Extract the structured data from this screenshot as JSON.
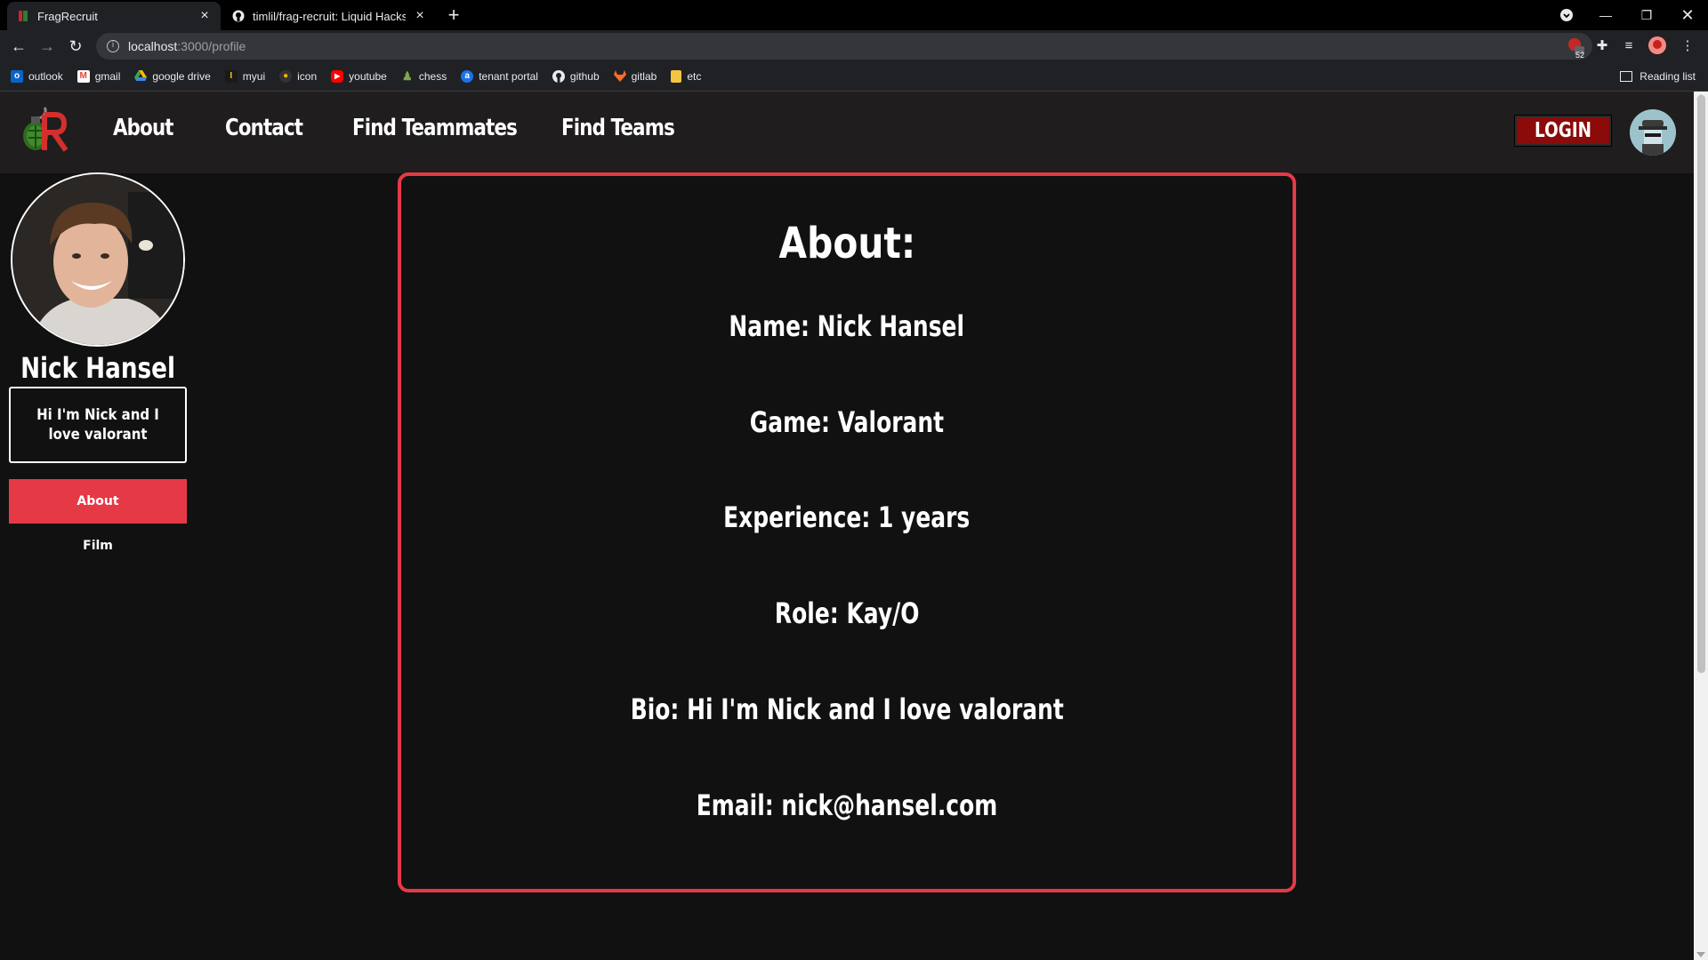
{
  "browser": {
    "tabs": [
      {
        "title": "FragRecruit",
        "active": true
      },
      {
        "title": "timlil/frag-recruit: Liquid Hacks 2",
        "active": false
      }
    ],
    "url_host": "localhost",
    "url_rest": ":3000/profile",
    "extension_badge": "52",
    "bookmarks": [
      {
        "label": "outlook",
        "icon": "outlook-icon",
        "color": "#0a64c8"
      },
      {
        "label": "gmail",
        "icon": "gmail-icon",
        "color": "#ea4335"
      },
      {
        "label": "google drive",
        "icon": "google-drive-icon",
        "color": "#34a853"
      },
      {
        "label": "myui",
        "icon": "myui-icon",
        "color": "#ffcc00"
      },
      {
        "label": "icon",
        "icon": "icon-icon",
        "color": "#f4b400"
      },
      {
        "label": "youtube",
        "icon": "youtube-icon",
        "color": "#ff0000"
      },
      {
        "label": "chess",
        "icon": "chess-icon",
        "color": "#7fa650"
      },
      {
        "label": "tenant portal",
        "icon": "tenant-portal-icon",
        "color": "#1a73e8"
      },
      {
        "label": "github",
        "icon": "github-icon",
        "color": "#ffffff"
      },
      {
        "label": "gitlab",
        "icon": "gitlab-icon",
        "color": "#fc6d26"
      },
      {
        "label": "etc",
        "icon": "folder-icon",
        "color": "#f4c542"
      }
    ],
    "reading_list": "Reading list"
  },
  "nav": {
    "links": [
      "About",
      "Contact",
      "Find Teammates",
      "Find Teams"
    ],
    "login": "LOGIN"
  },
  "profile": {
    "name": "Nick Hansel",
    "bio_short": "Hi I'm Nick and I love valorant",
    "menu": [
      "About",
      "Film"
    ]
  },
  "about": {
    "title": "About:",
    "rows": [
      "Name: Nick Hansel",
      "Game: Valorant",
      "Experience: 1 years",
      "Role: Kay/O",
      "Bio: Hi I'm Nick and I love valorant",
      "Email: nick@hansel.com"
    ]
  },
  "colors": {
    "accent": "#e63946",
    "login_bg": "#8b0a0a",
    "page_bg": "#111112",
    "nav_bg": "#1f1d1d"
  }
}
